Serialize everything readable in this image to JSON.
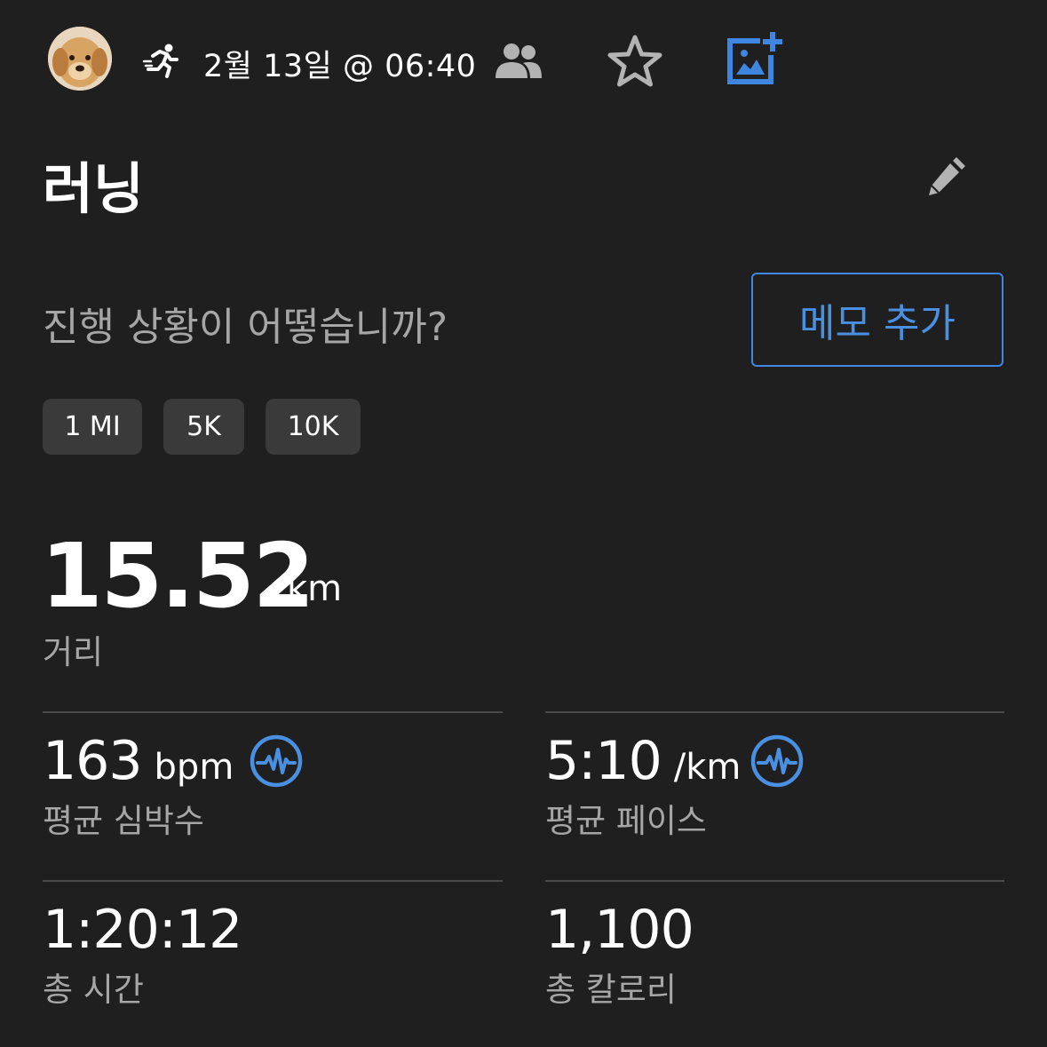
{
  "header": {
    "date_time": "2월 13일 @ 06:40",
    "icons": [
      "avatar",
      "running-icon",
      "people-icon",
      "star-icon",
      "add-photo-icon"
    ],
    "accent_color": "#3f86e0"
  },
  "activity": {
    "title": "러닝",
    "prompt": "진행 상황이 어떻습니까?",
    "add_note_label": "메모 추가"
  },
  "distance_chips": [
    "1 MI",
    "5K",
    "10K"
  ],
  "main_metric": {
    "value": "15.52",
    "unit": "km",
    "label": "거리"
  },
  "stats": [
    {
      "value": "163",
      "unit": "bpm",
      "label": "평균 심박수",
      "icon": "heart-rate-icon"
    },
    {
      "value": "5:10",
      "unit": "/km",
      "label": "평균 페이스",
      "icon": "heart-rate-icon"
    },
    {
      "value": "1:20:12",
      "unit": "",
      "label": "총 시간"
    },
    {
      "value": "1,100",
      "unit": "",
      "label": "총 칼로리"
    }
  ]
}
